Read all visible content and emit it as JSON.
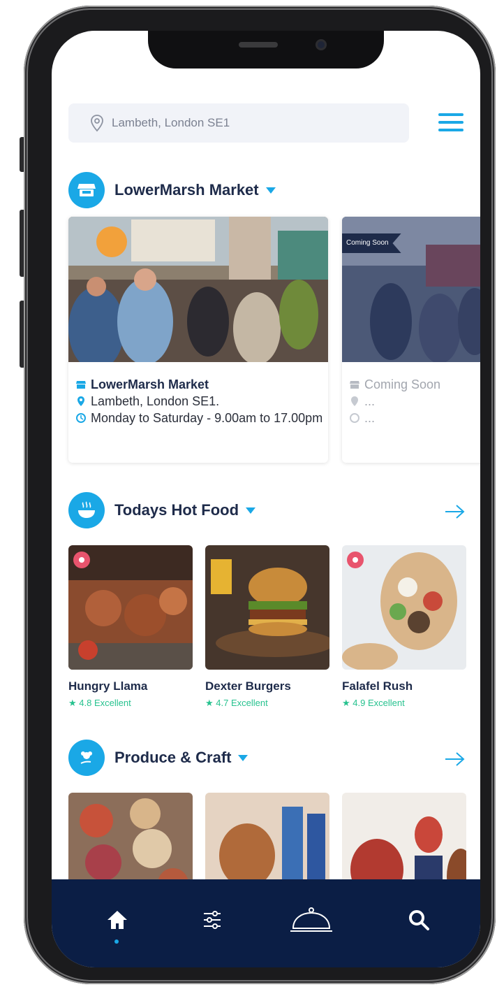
{
  "search": {
    "location": "Lambeth, London SE1"
  },
  "sections": {
    "market": {
      "title": "LowerMarsh Market"
    },
    "hot_food": {
      "title": "Todays Hot Food"
    },
    "produce": {
      "title": "Produce & Craft"
    }
  },
  "markets": [
    {
      "badge": "",
      "name": "LowerMarsh Market",
      "location": "Lambeth, London SE1.",
      "hours": "Monday to Saturday - 9.00am to 17.00pm"
    },
    {
      "badge": "Coming Soon",
      "name": "Coming Soon",
      "location": "...",
      "hours": "..."
    }
  ],
  "food": [
    {
      "name": "Hungry Llama",
      "rating": "4.8 Excellent"
    },
    {
      "name": "Dexter Burgers",
      "rating": "4.7 Excellent"
    },
    {
      "name": "Falafel Rush",
      "rating": "4.9  Excellent"
    }
  ],
  "tabs": [
    "home-icon",
    "filters-icon",
    "cloche-icon",
    "search-icon"
  ],
  "colors": {
    "accent": "#1aa8e6",
    "navy": "#0b1e45",
    "title": "#1e2b4a",
    "rating": "#27c28f"
  }
}
